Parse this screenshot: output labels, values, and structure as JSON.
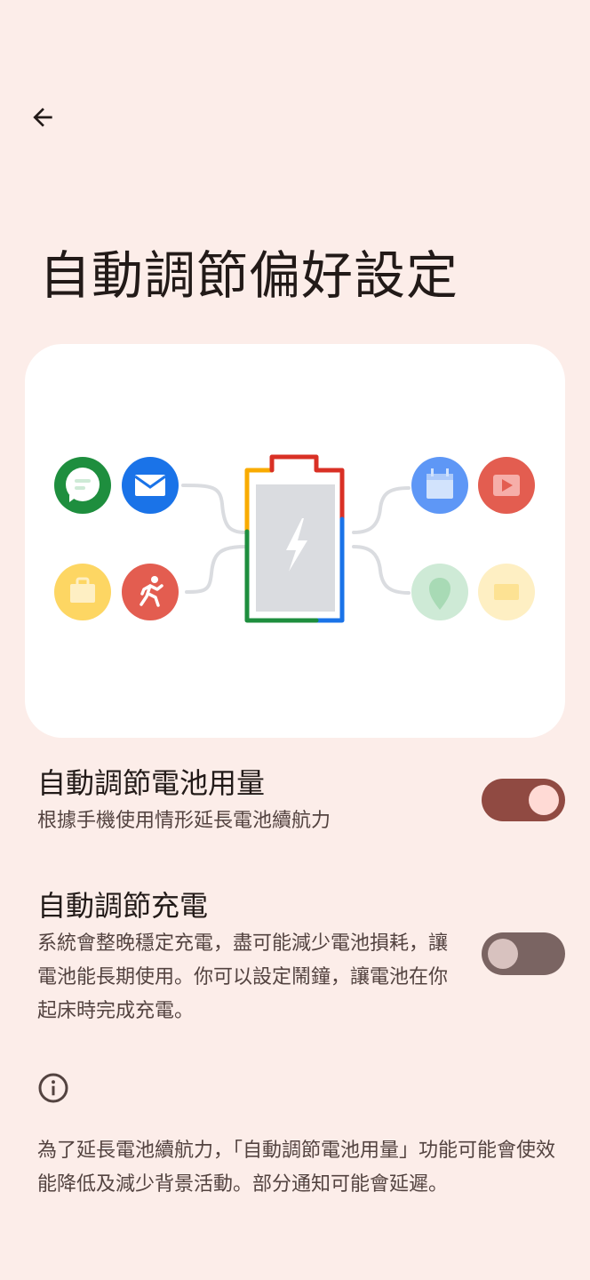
{
  "header": {
    "back_icon": "arrow-back-icon",
    "title": "自動調節偏好設定"
  },
  "illustration": {
    "left_icons": [
      "messages-icon",
      "email-icon",
      "briefcase-icon",
      "running-icon"
    ],
    "right_icons": [
      "calendar-icon",
      "video-icon",
      "location-icon",
      "envelope-icon"
    ],
    "center_icon": "battery-charging-icon"
  },
  "adaptive_battery": {
    "title": "自動調節電池用量",
    "summary": "根據手機使用情形延長電池續航力",
    "enabled": true
  },
  "adaptive_charging": {
    "title": "自動調節充電",
    "summary": "系統會整晚穩定充電，盡可能減少電池損耗，讓電池能長期使用。你可以設定鬧鐘，讓電池在你起床時完成充電。",
    "enabled": false
  },
  "footer": {
    "icon": "info-icon",
    "text": "為了延長電池續航力，「自動調節電池用量」功能可能會使效能降低及減少背景活動。部分通知可能會延遲。"
  },
  "colors": {
    "background": "#FCEDE9",
    "toggle_on": "#904A42",
    "toggle_off": "#7A6462",
    "google_blue": "#1A73E8",
    "google_red": "#D93025",
    "google_yellow": "#F9AB00",
    "google_green": "#1E8E3E"
  }
}
